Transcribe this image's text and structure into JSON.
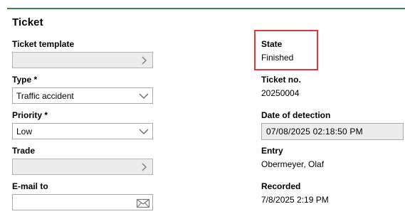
{
  "section": {
    "title": "Ticket"
  },
  "left": {
    "ticket_template": {
      "label": "Ticket template",
      "value": ""
    },
    "type": {
      "label": "Type *",
      "value": "Traffic accident"
    },
    "priority": {
      "label": "Priority *",
      "value": "Low"
    },
    "trade": {
      "label": "Trade",
      "value": ""
    },
    "email_to": {
      "label": "E-mail to",
      "value": ""
    }
  },
  "right": {
    "state": {
      "label": "State",
      "value": "Finished"
    },
    "ticket_no": {
      "label": "Ticket no.",
      "value": "20250004"
    },
    "date_of_detection": {
      "label": "Date of detection",
      "value": "07/08/2025 02:18:50 PM"
    },
    "entry": {
      "label": "Entry",
      "value": "Obermeyer, Olaf"
    },
    "recorded": {
      "label": "Recorded",
      "value": "7/8/2025 2:19 PM"
    }
  },
  "colors": {
    "accent_line": "#2e8b46",
    "highlight_border": "#e0383b",
    "disabled_field": "#ececec"
  },
  "icons": {
    "template_picker": "chevron-right-icon",
    "type_dropdown": "chevron-down-icon",
    "priority_dropdown": "chevron-down-icon",
    "trade_picker": "chevron-right-icon",
    "email": "envelope-icon"
  }
}
